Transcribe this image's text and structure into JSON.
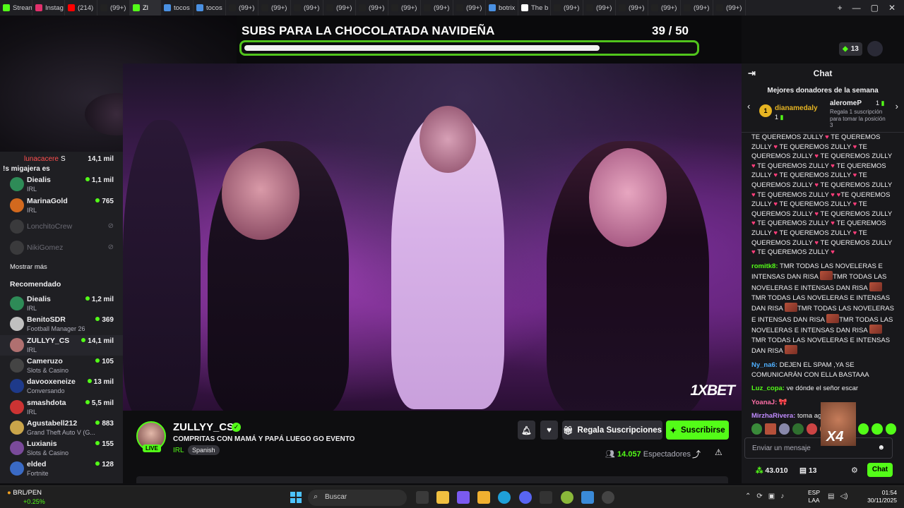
{
  "browser": {
    "tabs": [
      {
        "label": "Stream",
        "color": "#53fc18"
      },
      {
        "label": "Instag",
        "color": "#e1306c"
      },
      {
        "label": "(214)",
        "color": "#ff0000"
      },
      {
        "label": "(99+)",
        "color": "#222"
      },
      {
        "label": "Zl",
        "color": "#53fc18",
        "active": true
      },
      {
        "label": "tocos",
        "color": "#4a90e2"
      },
      {
        "label": "tocos",
        "color": "#4a90e2"
      },
      {
        "label": "(99+)",
        "color": "#222"
      },
      {
        "label": "(99+)",
        "color": "#222"
      },
      {
        "label": "(99+)",
        "color": "#222"
      },
      {
        "label": "(99+)",
        "color": "#222"
      },
      {
        "label": "(99+)",
        "color": "#222"
      },
      {
        "label": "(99+)",
        "color": "#222"
      },
      {
        "label": "(99+)",
        "color": "#222"
      },
      {
        "label": "(99+)",
        "color": "#222"
      },
      {
        "label": "botrix",
        "color": "#4a90e2"
      },
      {
        "label": "The b",
        "color": "#fff"
      },
      {
        "label": "(99+)",
        "color": "#222"
      },
      {
        "label": "(99+)",
        "color": "#222"
      },
      {
        "label": "(99+)",
        "color": "#222"
      },
      {
        "label": "(99+)",
        "color": "#222"
      },
      {
        "label": "(99+)",
        "color": "#222"
      },
      {
        "label": "(99+)",
        "color": "#222"
      }
    ],
    "chat_button": "Chat"
  },
  "goal": {
    "title": "SUBS PARA LA CHOCOLATADA NAVIDEÑA",
    "count": "39  / 50",
    "progress": 0.78
  },
  "sidebar": {
    "top_partial": {
      "name": "lunacacere",
      "name_suffix": "S",
      "extra": "!s migajera es",
      "viewers": "14,1 mil"
    },
    "following": [
      {
        "name": "Diealis",
        "category": "IRL",
        "viewers": "1,1 mil",
        "color": "#2e8b57"
      },
      {
        "name": "MarinaGold",
        "category": "IRL",
        "viewers": "765",
        "color": "#d2691e"
      }
    ],
    "offline": [
      {
        "name": "LonchitoCrew"
      },
      {
        "name": "NikiGomez"
      }
    ],
    "show_more": "Mostrar más",
    "recommended_heading": "Recomendado",
    "recommended": [
      {
        "name": "Diealis",
        "category": "IRL",
        "viewers": "1,2 mil",
        "color": "#2e8b57"
      },
      {
        "name": "BenitoSDR",
        "category": "Football Manager 26",
        "viewers": "369",
        "color": "#c0c0c0"
      },
      {
        "name": "ZULLYY_CS",
        "category": "IRL",
        "viewers": "14,1 mil",
        "color": "#b07070",
        "selected": true
      },
      {
        "name": "Cameruzo",
        "category": "Slots & Casino",
        "viewers": "105",
        "color": "#444"
      },
      {
        "name": "davooxeneize",
        "category": "Conversando",
        "viewers": "13 mil",
        "color": "#1e3a8a"
      },
      {
        "name": "smashdota",
        "category": "IRL",
        "viewers": "5,5 mil",
        "color": "#cc3333"
      },
      {
        "name": "Agustabell212",
        "category": "Grand Theft Auto V (G...",
        "viewers": "883",
        "color": "#caa54a"
      },
      {
        "name": "Luxianis",
        "category": "Slots & Casino",
        "viewers": "155",
        "color": "#7a4a9a"
      },
      {
        "name": "elded",
        "category": "Fortnite",
        "viewers": "128",
        "color": "#3a6ac4"
      }
    ]
  },
  "stream": {
    "username": "ZULLYY_CS",
    "live_badge": "LIVE",
    "title": "COMPRITAS CON MAMÁ Y PAPÁ LUEGO GO EVENTO",
    "category": "IRL",
    "language": "Spanish",
    "gift_button": "Regala Suscripciones",
    "subscribe_button": "Suscribirse",
    "viewers": "14.057",
    "viewers_label": "Espectadores",
    "sponsor_logo": "1XBET"
  },
  "chat": {
    "header": "Chat",
    "top_count": "13",
    "donors_title": "Mejores donadores de la semana",
    "donor1": {
      "rank": "1",
      "name": "dianamedaly",
      "count": "1"
    },
    "donor2": {
      "name": "aleromeP",
      "count": "1",
      "tip": "Regala 1 suscripción para tomar la posición 3"
    },
    "messages": [
      {
        "user": "",
        "color": "#efeff1",
        "text": "TE QUEREMOS ZULLY ♥ TE QUEREMOS ZULLY ♥ TE QUEREMOS ZULLY ♥ TE QUEREMOS ZULLY ♥ TE QUEREMOS ZULLY ♥ TE QUEREMOS ZULLY ♥ TE QUEREMOS ZULLY ♥ TE QUEREMOS ZULLY ♥ TE QUEREMOS ZULLY ♥ TE QUEREMOS ZULLY ♥ TE QUEREMOS ZULLY ♥ ♥TE QUEREMOS ZULLY ♥ TE QUEREMOS ZULLY ♥ TE QUEREMOS ZULLY ♥ TE QUEREMOS ZULLY ♥ TE QUEREMOS ZULLY ♥ TE QUEREMOS ZULLY ♥ TE QUEREMOS ZULLY ♥ TE QUEREMOS ZULLY ♥ TE QUEREMOS ZULLY ♥ TE QUEREMOS ZULLY ♥"
      },
      {
        "user": "romitk8:",
        "color": "#53fc18",
        "text": "TMR TODAS LAS NOVELERAS E INTENSAS DAN RISA ▣TMR TODAS LAS NOVELERAS E INTENSAS DAN RISA ▣TMR TODAS LAS NOVELERAS E INTENSAS DAN RISA ▣TMR TODAS LAS NOVELERAS E INTENSAS DAN RISA ▣TMR TODAS LAS NOVELERAS E INTENSAS DAN RISA ▣TMR TODAS LAS NOVELERAS E INTENSAS DAN RISA ▣"
      },
      {
        "user": "Ny_na6:",
        "color": "#4fb0ff",
        "text": "DEJEN EL SPAM ,YA SE COMUNICARÁN CON ELLA BASTAAA"
      },
      {
        "user": "Luz_copa:",
        "color": "#53fc18",
        "text": "ve dónde el señor escar"
      },
      {
        "user": "YoanaJ:",
        "color": "#ff6fa8",
        "text": "🎀"
      },
      {
        "user": "MirzhaRivera:",
        "color": "#c08bff",
        "text": "toma agu"
      }
    ],
    "overlay_text": "X4",
    "input_placeholder": "Enviar un mensaje",
    "points": "43.010",
    "subs": "13",
    "send_button": "Chat"
  },
  "taskbar": {
    "ticker": "BRL/PEN",
    "ticker_change": "+0.25%",
    "search_placeholder": "Buscar",
    "lang_top": "ESP",
    "lang_bottom": "LAA",
    "time": "01:54",
    "date": "30/11/2025"
  }
}
